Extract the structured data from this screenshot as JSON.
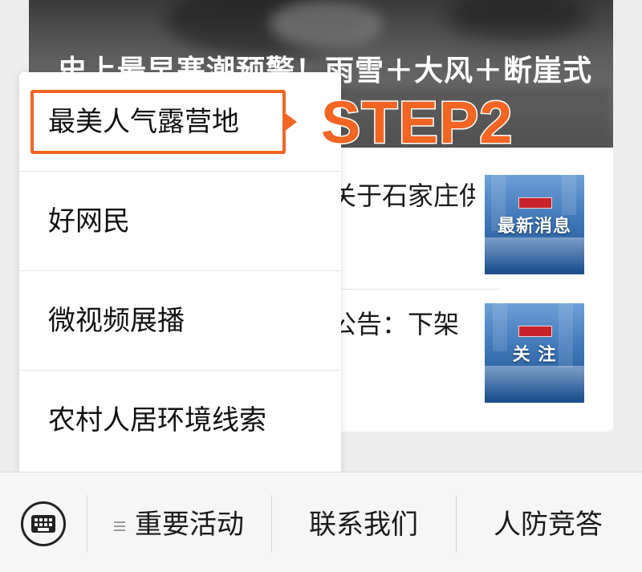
{
  "article": {
    "hero_title": "史上最早寒潮预警！雨雪＋大风＋断崖式",
    "items": [
      {
        "text": "关于石家庄供",
        "thumb_text": "最新消息"
      },
      {
        "text": "公告：下架",
        "thumb_text": "关 注"
      }
    ]
  },
  "popup_menu": {
    "items": [
      {
        "label": "最美人气露营地"
      },
      {
        "label": "好网民"
      },
      {
        "label": "微视频展播"
      },
      {
        "label": "农村人居环境线索"
      }
    ]
  },
  "annotation": {
    "step_label": "STEP2",
    "color": "#f26522"
  },
  "bottom_bar": {
    "keyboard_icon": "keyboard-icon",
    "menu_icon": "hamburger-icon",
    "tabs": [
      {
        "label": "重要活动"
      },
      {
        "label": "联系我们"
      },
      {
        "label": "人防竞答"
      }
    ]
  }
}
